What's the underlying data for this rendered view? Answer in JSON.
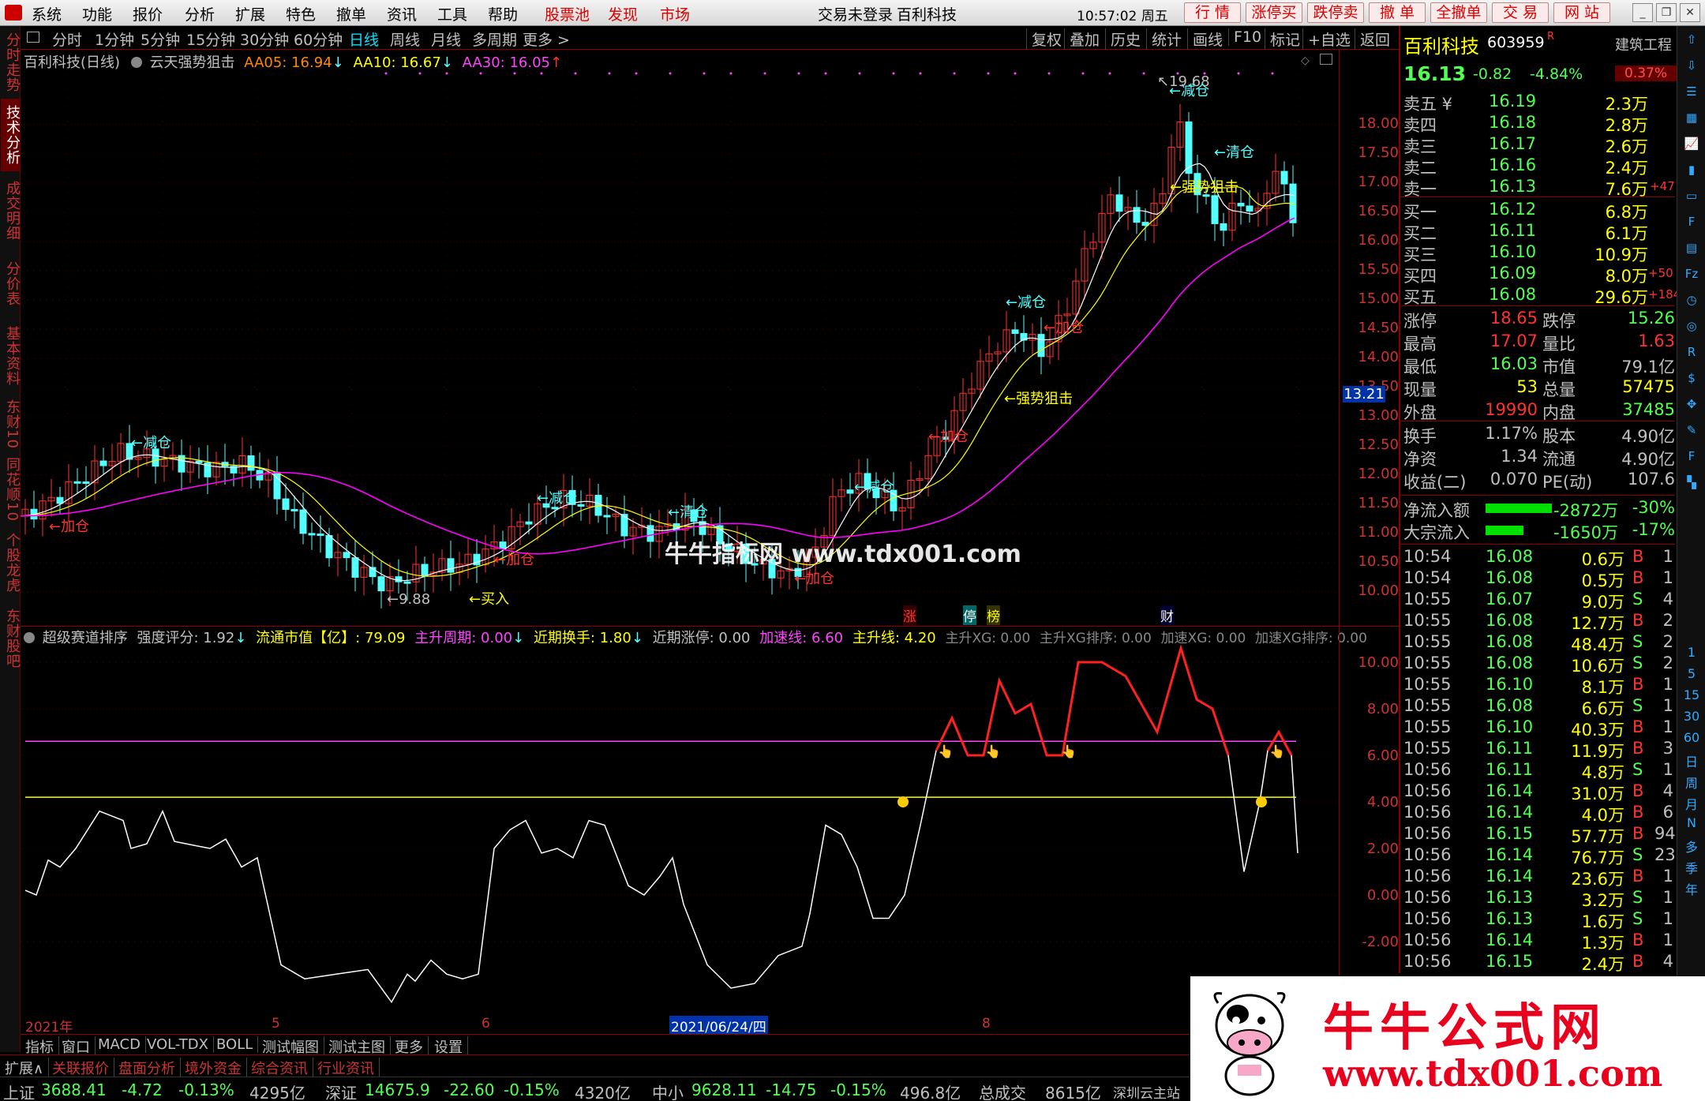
{
  "menu": {
    "items": [
      "系统",
      "功能",
      "报价",
      "分析",
      "扩展",
      "特色",
      "撤单",
      "资讯",
      "工具",
      "帮助"
    ],
    "red_items": [
      "股票池",
      "发现",
      "市场"
    ],
    "login_status": "交易未登录",
    "stock_name": "百利科技",
    "clock": "10:57:02 周五",
    "quick_buttons": [
      "行 情",
      "涨停买",
      "跌停卖",
      "撤 单",
      "全撤单",
      "交 易",
      "网 站"
    ]
  },
  "left_tabs": [
    "分时走势",
    "技术分析",
    "成交明细",
    "分价表",
    "基本资料",
    "东财10",
    "同花顺10",
    "个股龙虎",
    "东财股吧"
  ],
  "periods": [
    "分时",
    "1分钟",
    "5分钟",
    "15分钟",
    "30分钟",
    "60分钟",
    "日线",
    "周线",
    "月线",
    "多周期",
    "更多 >"
  ],
  "active_period": "日线",
  "tools": [
    "复权",
    "叠加",
    "历史",
    "统计",
    "画线",
    "F10",
    "标记",
    "+自选",
    "返回"
  ],
  "main_legend": {
    "title": "百利科技(日线)",
    "indicator": "云天强势狙击",
    "ma5": "AA05: 16.94",
    "ma10": "AA10: 16.67",
    "ma30": "AA30: 16.05"
  },
  "price_axis": [
    "18.00",
    "17.50",
    "17.00",
    "16.50",
    "16.00",
    "15.50",
    "15.00",
    "14.50",
    "14.00",
    "13.50",
    "13.00",
    "12.50",
    "12.00",
    "11.50",
    "11.00",
    "10.50",
    "10.00"
  ],
  "current_price_tag": "13.21",
  "annotations": {
    "high": "19.68",
    "low": "9.88",
    "reduce": "减仓",
    "add": "加仓",
    "clear": "清仓",
    "buy": "买入",
    "strong": "强势狙击"
  },
  "event_tags": [
    "涨",
    "停",
    "榜",
    "财"
  ],
  "sub_legend": {
    "name": "超级赛道排序",
    "score": "强度评分: 1.92",
    "mcap": "流通市值【亿】: 79.09",
    "cycle": "主升周期: 0.00",
    "turnover": "近期换手: 1.80",
    "limitup": "近期涨停: 0.00",
    "accel": "加速线: 6.60",
    "mainline": "主升线: 4.20",
    "xg1": "主升XG: 0.00",
    "xg2": "主升XG排序: 0.00",
    "xg3": "加速XG: 0.00",
    "xg4": "加速XG排序: 0.00"
  },
  "sub_axis": [
    "10.00",
    "8.00",
    "6.00",
    "4.00",
    "2.00",
    "0.00",
    "-2.00"
  ],
  "date_axis": {
    "year": "2021年",
    "m5": "5",
    "m6": "6",
    "cursor": "2021/06/24/四",
    "m8": "8"
  },
  "bottom_tabs": [
    "指标",
    "窗口",
    "MACD",
    "VOL-TDX",
    "BOLL",
    "测试幅图",
    "测试主图",
    "更多",
    "设置"
  ],
  "ext_tabs": [
    "扩展∧",
    "关联报价",
    "盘面分析",
    "境外资金",
    "综合资讯",
    "行业资讯"
  ],
  "status": {
    "sh_label": "上证",
    "sh_val": "3688.41",
    "sh_chg": "-4.72",
    "sh_pct": "-0.13%",
    "sh_amt": "4295亿",
    "sz_label": "深证",
    "sz_val": "14675.9",
    "sz_chg": "-22.60",
    "sz_pct": "-0.15%",
    "sz_amt": "4320亿",
    "zx_label": "中小",
    "zx_val": "9628.11",
    "zx_chg": "-14.75",
    "zx_pct": "-0.15%",
    "zx_amt": "496.8亿",
    "total_label": "总成交",
    "total_amt": "8615亿",
    "site": "深圳云主站"
  },
  "quote": {
    "name": "百利科技",
    "code": "603959",
    "r": "R",
    "sector": "建筑工程",
    "price": "16.13",
    "chg": "-0.82",
    "pct": "-4.84%",
    "badge": "0.37%",
    "asks": [
      {
        "label": "卖五",
        "yen": "¥",
        "price": "16.19",
        "vol": "2.3万",
        "ex": ""
      },
      {
        "label": "卖四",
        "yen": "",
        "price": "16.18",
        "vol": "2.8万",
        "ex": ""
      },
      {
        "label": "卖三",
        "yen": "",
        "price": "16.17",
        "vol": "2.6万",
        "ex": ""
      },
      {
        "label": "卖二",
        "yen": "",
        "price": "16.16",
        "vol": "2.4万",
        "ex": ""
      },
      {
        "label": "卖一",
        "yen": "",
        "price": "16.13",
        "vol": "7.6万",
        "ex": "+47"
      }
    ],
    "bids": [
      {
        "label": "买一",
        "price": "16.12",
        "vol": "6.8万",
        "ex": ""
      },
      {
        "label": "买二",
        "price": "16.11",
        "vol": "6.1万",
        "ex": ""
      },
      {
        "label": "买三",
        "price": "16.10",
        "vol": "10.9万",
        "ex": ""
      },
      {
        "label": "买四",
        "price": "16.09",
        "vol": "8.0万",
        "ex": "+50"
      },
      {
        "label": "买五",
        "price": "16.08",
        "vol": "29.6万",
        "ex": "+184"
      }
    ],
    "stats": [
      {
        "l1": "涨停",
        "v1": "18.65",
        "l2": "跌停",
        "v2": "15.26"
      },
      {
        "l1": "最高",
        "v1": "17.07",
        "l2": "量比",
        "v2": "1.63"
      },
      {
        "l1": "最低",
        "v1": "16.03",
        "l2": "市值",
        "v2": "79.1亿"
      },
      {
        "l1": "现量",
        "v1": "53",
        "l2": "总量",
        "v2": "57475"
      },
      {
        "l1": "外盘",
        "v1": "19990",
        "l2": "内盘",
        "v2": "37485"
      }
    ],
    "stats2": [
      {
        "l1": "换手",
        "v1": "1.17%",
        "l2": "股本",
        "v2": "4.90亿"
      },
      {
        "l1": "净资",
        "v1": "1.34",
        "l2": "流通",
        "v2": "4.90亿"
      },
      {
        "l1": "收益(二)",
        "v1": "0.070",
        "l2": "PE(动)",
        "v2": "107.6"
      }
    ],
    "flows": [
      {
        "label": "净流入额",
        "amt": "-2872万",
        "pct": "-30%"
      },
      {
        "label": "大宗流入",
        "amt": "-1650万",
        "pct": "-17%"
      }
    ],
    "ticks": [
      {
        "t": "10:54",
        "p": "16.08",
        "v": "0.6万",
        "s": "B",
        "n": "1"
      },
      {
        "t": "10:54",
        "p": "16.08",
        "v": "0.5万",
        "s": "B",
        "n": "1"
      },
      {
        "t": "10:55",
        "p": "16.07",
        "v": "9.0万",
        "s": "S",
        "n": "4"
      },
      {
        "t": "10:55",
        "p": "16.08",
        "v": "12.7万",
        "s": "B",
        "n": "2"
      },
      {
        "t": "10:55",
        "p": "16.08",
        "v": "48.4万",
        "s": "S",
        "n": "2"
      },
      {
        "t": "10:55",
        "p": "16.08",
        "v": "10.6万",
        "s": "S",
        "n": "2"
      },
      {
        "t": "10:55",
        "p": "16.10",
        "v": "8.1万",
        "s": "B",
        "n": "1"
      },
      {
        "t": "10:55",
        "p": "16.08",
        "v": "6.6万",
        "s": "S",
        "n": "1"
      },
      {
        "t": "10:55",
        "p": "16.10",
        "v": "40.3万",
        "s": "B",
        "n": "1"
      },
      {
        "t": "10:55",
        "p": "16.11",
        "v": "11.9万",
        "s": "B",
        "n": "3"
      },
      {
        "t": "10:56",
        "p": "16.11",
        "v": "4.8万",
        "s": "S",
        "n": "1"
      },
      {
        "t": "10:56",
        "p": "16.14",
        "v": "31.0万",
        "s": "B",
        "n": "4"
      },
      {
        "t": "10:56",
        "p": "16.14",
        "v": "4.0万",
        "s": "B",
        "n": "6"
      },
      {
        "t": "10:56",
        "p": "16.15",
        "v": "57.7万",
        "s": "B",
        "n": "94"
      },
      {
        "t": "10:56",
        "p": "16.14",
        "v": "76.7万",
        "s": "S",
        "n": "23"
      },
      {
        "t": "10:56",
        "p": "16.14",
        "v": "23.6万",
        "s": "B",
        "n": "1"
      },
      {
        "t": "10:56",
        "p": "16.13",
        "v": "3.2万",
        "s": "S",
        "n": "1"
      },
      {
        "t": "10:56",
        "p": "16.13",
        "v": "1.6万",
        "s": "S",
        "n": "1"
      },
      {
        "t": "10:56",
        "p": "16.14",
        "v": "1.3万",
        "s": "B",
        "n": "1"
      },
      {
        "t": "10:56",
        "p": "16.15",
        "v": "2.4万",
        "s": "B",
        "n": "4"
      }
    ]
  },
  "right_icons": [
    "up-arrow-icon",
    "down-arrow-icon",
    "list-icon",
    "grid-icon",
    "chart-icon",
    "candle-icon",
    "window-icon",
    "f10-icon",
    "fund-icon",
    "fz-icon",
    "clock-icon",
    "gauge-icon",
    "rsi-icon",
    "coin-icon",
    "cross-icon",
    "pen-icon",
    "fs-icon",
    "chart2-icon"
  ],
  "right_period_labels": [
    "1",
    "5",
    "15",
    "30",
    "60",
    "日",
    "周",
    "月",
    "N",
    "多",
    "季",
    "年"
  ],
  "watermark": {
    "center": "牛牛指标网  www.tdx001.com",
    "brand": "牛牛公式网",
    "url": "www.tdx001.com"
  },
  "colors": {
    "up": "#ff3232",
    "down": "#54ffff",
    "ma5": "#ffffff",
    "ma10": "#ffff00",
    "ma30": "#ff00ff",
    "bg": "#000000"
  }
}
